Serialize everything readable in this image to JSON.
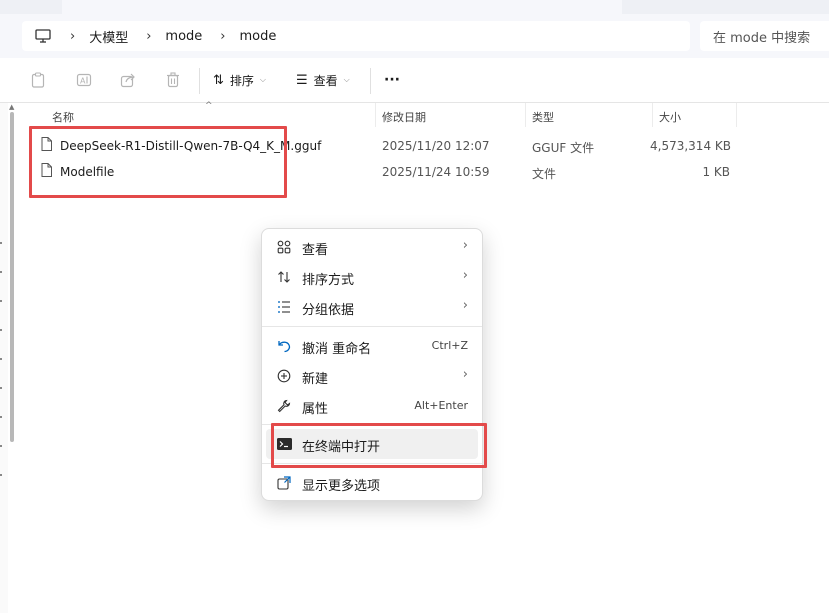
{
  "address_bar": {
    "breadcrumbs": [
      "大模型",
      "mode",
      "mode"
    ],
    "search_placeholder": "在 mode 中搜索"
  },
  "toolbar": {
    "sort_label": "排序",
    "view_label": "查看",
    "more_label": "···"
  },
  "columns": {
    "name": "名称",
    "modified": "修改日期",
    "type": "类型",
    "size": "大小"
  },
  "files": [
    {
      "name": "DeepSeek-R1-Distill-Qwen-7B-Q4_K_M.gguf",
      "modified": "2025/11/20 12:07",
      "type": "GGUF 文件",
      "size": "4,573,314 KB"
    },
    {
      "name": "Modelfile",
      "modified": "2025/11/24 10:59",
      "type": "文件",
      "size": "1 KB"
    }
  ],
  "context_menu": {
    "view": "查看",
    "sort_by": "排序方式",
    "group_by": "分组依据",
    "undo": "撤消 重命名",
    "undo_shortcut": "Ctrl+Z",
    "new": "新建",
    "properties": "属性",
    "properties_shortcut": "Alt+Enter",
    "open_terminal": "在终端中打开",
    "more_options": "显示更多选项",
    "chevron": "›"
  },
  "colors": {
    "highlight_box": "#e34a4a",
    "accent": "#0067c0"
  }
}
